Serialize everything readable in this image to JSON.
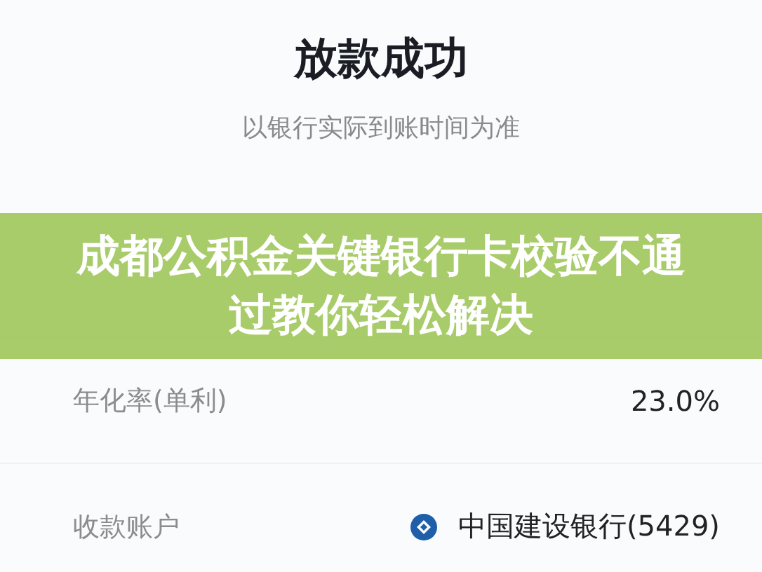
{
  "header": {
    "title": "放款成功",
    "subtitle": "以银行实际到账时间为准"
  },
  "rows": [
    {
      "kind": "hidden"
    },
    {
      "kind": "plain",
      "label": "年化率(单利)",
      "value": "23.0%"
    },
    {
      "kind": "bank",
      "label": "收款账户",
      "value": "中国建设银行(5429)"
    }
  ],
  "banner": {
    "title": "成都公积金关键银行卡校验不通过教你轻松解决"
  }
}
